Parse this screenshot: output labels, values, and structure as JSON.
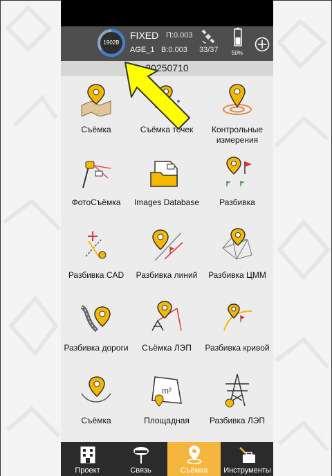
{
  "status": {
    "base_id": "1902B",
    "fix": "FIXED",
    "precision_h": "П:0.003",
    "age": "AGE_1",
    "precision_v": "В:0.003",
    "satellites": "33/37",
    "battery": "50%"
  },
  "project_date": "20250710",
  "tiles": [
    {
      "label": "Съёмка"
    },
    {
      "label": "Съёмка точек"
    },
    {
      "label": "Контрольные измерения"
    },
    {
      "label": "ФотоСъёмка"
    },
    {
      "label": "Images Database"
    },
    {
      "label": "Разбивка"
    },
    {
      "label": "Разбивка CAD"
    },
    {
      "label": "Разбивка линий"
    },
    {
      "label": "Разбивка ЦММ"
    },
    {
      "label": "Разбивка дороги"
    },
    {
      "label": "Съёмка ЛЭП"
    },
    {
      "label": "Разбивка кривой"
    },
    {
      "label": "Съёмка"
    },
    {
      "label": "Площадная"
    },
    {
      "label": "Разбивка ЛЭП"
    }
  ],
  "nav": [
    {
      "label": "Проект"
    },
    {
      "label": "Связь"
    },
    {
      "label": "Съёмка"
    },
    {
      "label": "Инструменты"
    }
  ],
  "colors": {
    "accent": "#f4b63c",
    "status_bar": "#4e4e4e",
    "pin": "#f5b800"
  }
}
